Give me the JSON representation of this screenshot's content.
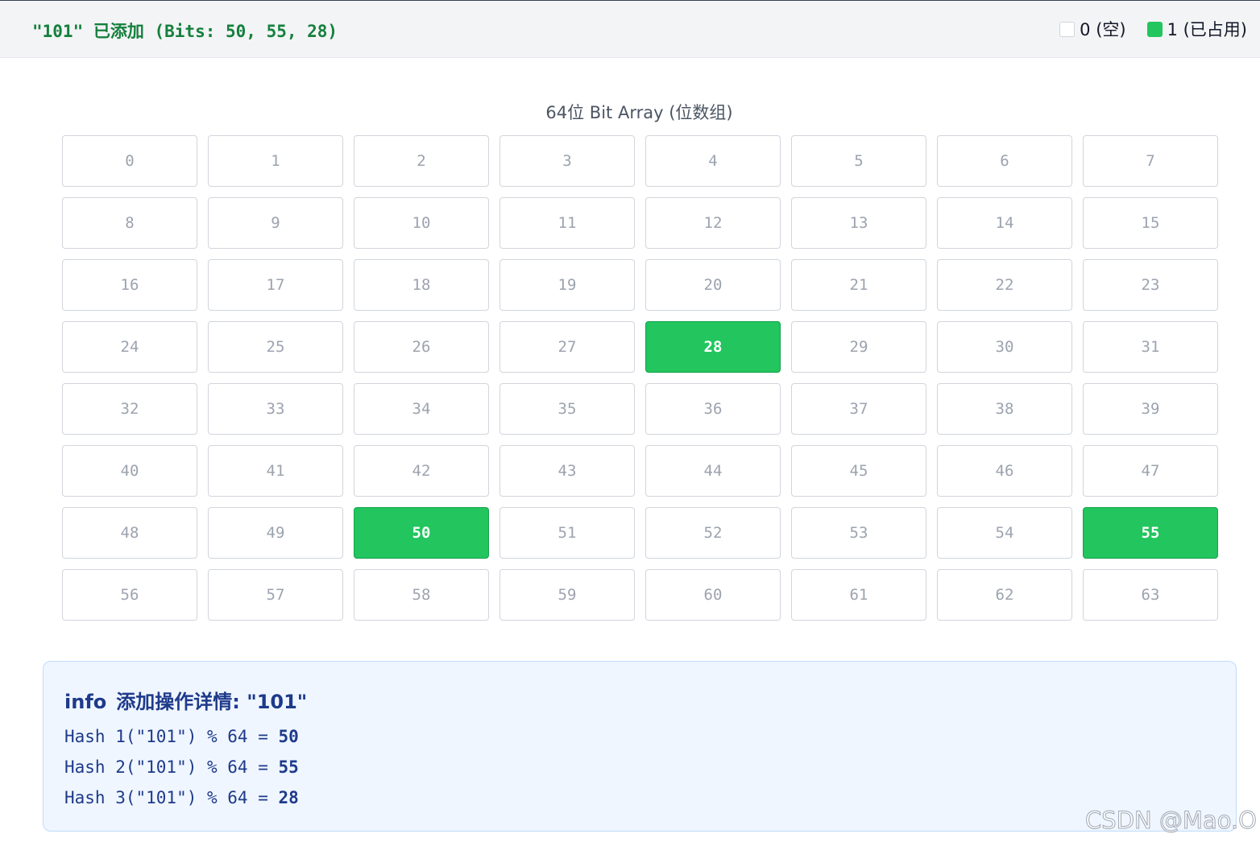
{
  "header": {
    "status_message": "\"101\" 已添加 (Bits: 50, 55, 28)",
    "legend": {
      "empty_label": "0 (空)",
      "used_label": "1 (已占用)"
    }
  },
  "bit_array": {
    "title": "64位 Bit Array (位数组)",
    "size": 64,
    "active_bits": [
      28,
      50,
      55
    ]
  },
  "info_panel": {
    "keyword": "info",
    "title": "添加操作详情: \"101\"",
    "hashes": [
      {
        "expr": "Hash 1(\"101\") % 64 = ",
        "result": "50"
      },
      {
        "expr": "Hash 2(\"101\") % 64 = ",
        "result": "55"
      },
      {
        "expr": "Hash 3(\"101\") % 64 = ",
        "result": "28"
      }
    ]
  },
  "colors": {
    "active": "#22c55e",
    "status_text": "#15803d",
    "info_text": "#1e3a8a",
    "info_bg": "#eff6ff"
  },
  "watermark": "CSDN @Mao.O"
}
